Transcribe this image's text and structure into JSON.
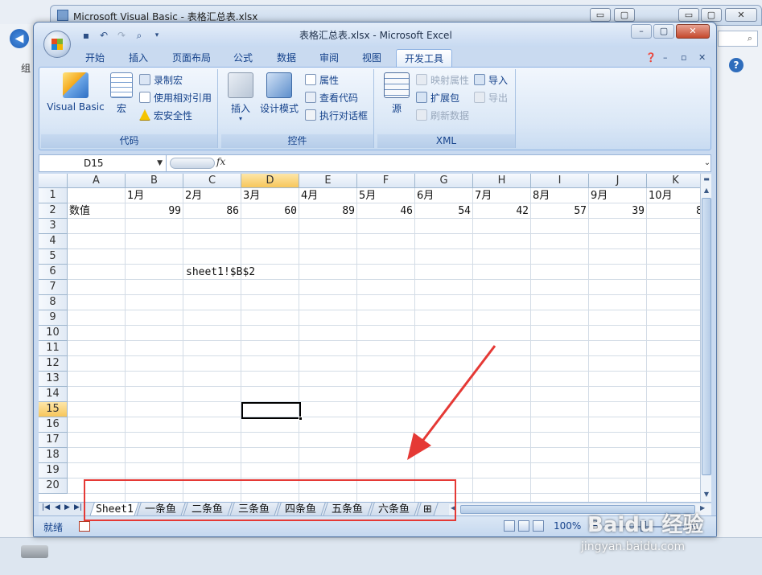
{
  "background": {
    "vba_title": "Microsoft Visual Basic - 表格汇总表.xlsx",
    "side_label": "组",
    "window_buttons": [
      "▭",
      "▢",
      "✕"
    ]
  },
  "window": {
    "title": "表格汇总表.xlsx - Microsoft Excel",
    "controls": [
      "–",
      "▢",
      "✕"
    ]
  },
  "tabs": [
    "开始",
    "插入",
    "页面布局",
    "公式",
    "数据",
    "审阅",
    "视图",
    "开发工具"
  ],
  "active_tab": "开发工具",
  "ribbon": {
    "code_group": {
      "label": "代码",
      "visual_basic": "Visual Basic",
      "macros": "宏",
      "record_macro": "录制宏",
      "relative_ref": "使用相对引用",
      "macro_security": "宏安全性"
    },
    "controls_group": {
      "label": "控件",
      "insert": "插入",
      "design_mode": "设计模式",
      "properties": "属性",
      "view_code": "查看代码",
      "run_dialog": "执行对话框"
    },
    "xml_group": {
      "label": "XML",
      "source": "源",
      "map_props": "映射属性",
      "expansion": "扩展包",
      "refresh": "刷新数据",
      "import": "导入",
      "export": "导出"
    }
  },
  "formula_bar": {
    "name_box": "D15",
    "fx": "fx",
    "formula": ""
  },
  "columns": [
    "A",
    "B",
    "C",
    "D",
    "E",
    "F",
    "G",
    "H",
    "I",
    "J",
    "K"
  ],
  "rows": [
    "1",
    "2",
    "3",
    "4",
    "5",
    "6",
    "7",
    "8",
    "9",
    "10",
    "11",
    "12",
    "13",
    "14",
    "15",
    "16",
    "17",
    "18",
    "19",
    "20"
  ],
  "cells": {
    "row1": [
      "",
      "1月",
      "2月",
      "3月",
      "4月",
      "5月",
      "6月",
      "7月",
      "8月",
      "9月",
      "10月"
    ],
    "row2": [
      "数值",
      "99",
      "86",
      "60",
      "89",
      "46",
      "54",
      "42",
      "57",
      "39",
      "8"
    ],
    "C6": "sheet1!$B$2"
  },
  "sheet_tabs": [
    "Sheet1",
    "一条鱼",
    "二条鱼",
    "三条鱼",
    "四条鱼",
    "五条鱼",
    "六条鱼"
  ],
  "active_sheet": "Sheet1",
  "status": {
    "ready": "就绪",
    "zoom": "100%"
  },
  "watermark": {
    "logo": "Baidu 经验",
    "url": "jingyan.baidu.com"
  }
}
